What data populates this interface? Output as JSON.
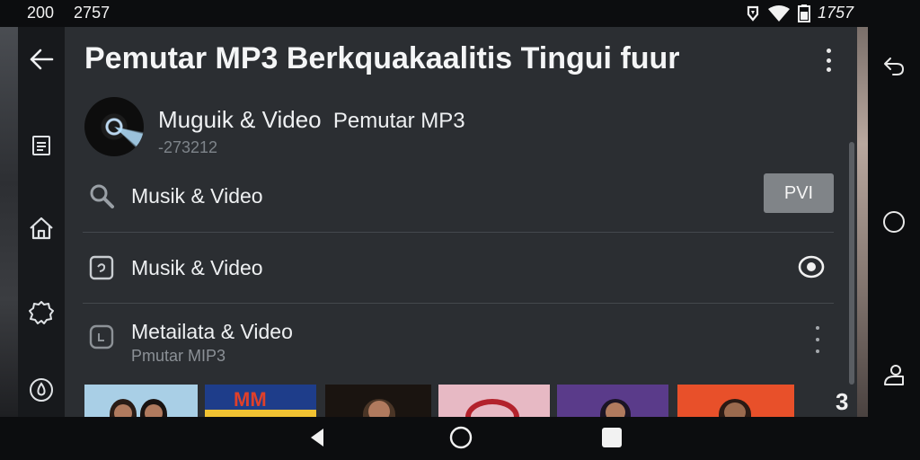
{
  "status_bar": {
    "time_left": "200",
    "time_left_2": "2757",
    "time_right": "1757"
  },
  "header": {
    "back_icon": "arrow-left-icon",
    "title": "Pemutar MP3 Berkquakaalitis Tingui fuur",
    "menu_icon": "more-vertical-icon"
  },
  "sidebar": {
    "items": [
      {
        "icon": "document-icon"
      },
      {
        "icon": "home-icon"
      },
      {
        "icon": "gear-icon"
      },
      {
        "icon": "drop-icon"
      }
    ]
  },
  "app_info": {
    "name": "Muguik & Video",
    "name_suffix": "Pemutar MP3",
    "subtitle": "-273212"
  },
  "list": [
    {
      "icon": "search-icon",
      "label": "Musik & Video",
      "action_label": "PVI"
    },
    {
      "icon": "media-icon",
      "label": "Musik & Video",
      "action_icon": "eye-icon"
    },
    {
      "icon": "media-icon",
      "label": "Metailata & Video",
      "sublabel": "Pmutar MIP3",
      "action_icon": "more-vertical-icon"
    }
  ],
  "thumbnails": {
    "items": [
      {
        "bg": "#a9cfe6",
        "caption": ""
      },
      {
        "bg": "#1e3d8a",
        "caption": "MM"
      },
      {
        "bg": "#1a1410",
        "caption": ""
      },
      {
        "bg": "#e7b9c4",
        "caption": ""
      },
      {
        "bg": "#5a3b8a",
        "caption": ""
      },
      {
        "bg": "#e8502a",
        "caption": ""
      }
    ],
    "more_label": "3"
  },
  "right_rail": {
    "items": [
      {
        "icon": "undo-icon"
      },
      {
        "icon": "circle-icon"
      },
      {
        "icon": "person-icon"
      }
    ]
  },
  "navigation": {
    "back": "back-triangle-icon",
    "home": "home-circle-icon",
    "recents": "recents-square-icon"
  }
}
